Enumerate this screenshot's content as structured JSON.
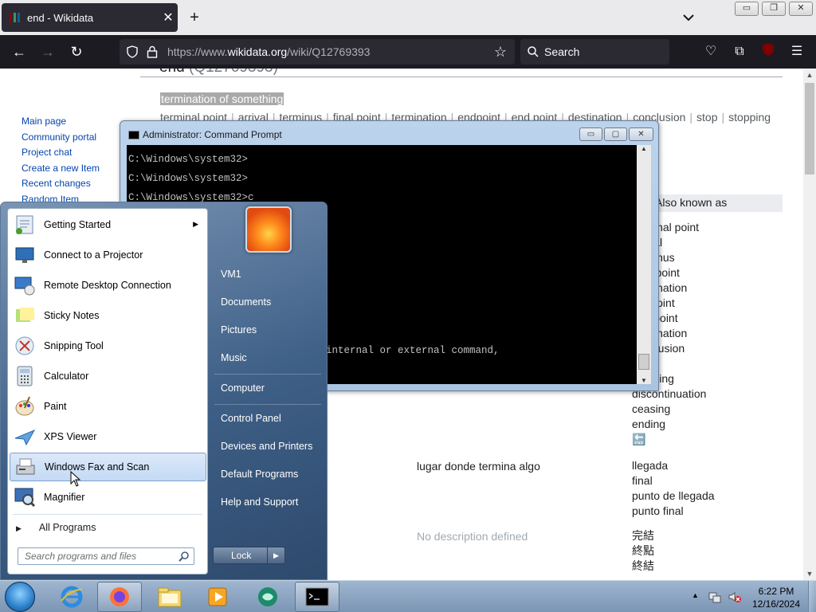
{
  "browser": {
    "tab_title": "end - Wikidata",
    "url_prefix": "https://www.",
    "url_domain": "wikidata.org",
    "url_path": "/wiki/Q12769393",
    "search_label": "Search"
  },
  "page": {
    "title": "end",
    "title_id": "(Q12769393)",
    "description": "termination of something",
    "aliases": [
      "terminal point",
      "arrival",
      "terminus",
      "final point",
      "termination",
      "endpoint",
      "end point",
      "destination",
      "conclusion",
      "stop",
      "stopping"
    ],
    "sidebar": [
      "Main page",
      "Community portal",
      "Project chat",
      "Create a new Item",
      "Recent changes",
      "Random Item"
    ],
    "also_known_as_header": "Also known as",
    "aliases_list_1": [
      "terminal point",
      "arrival",
      "terminus",
      "final point",
      "termination",
      "endpoint",
      "end point",
      "termination",
      "conclusion",
      "stop",
      "stopping",
      "discontinuation",
      "ceasing",
      "ending",
      "🔚"
    ],
    "spanish_description": "lugar donde termina algo",
    "spanish_aliases": [
      "llegada",
      "final",
      "punto de llegada",
      "punto final"
    ],
    "no_description": "No description defined",
    "chinese_aliases": [
      "完結",
      "終點",
      "終結"
    ]
  },
  "cmd": {
    "title": "Administrator: Command Prompt",
    "lines": [
      "C:\\Windows\\system32>",
      "C:\\Windows\\system32>",
      "C:\\Windows\\system32>c"
    ],
    "partial_line": "internal or external command,"
  },
  "start_menu": {
    "programs": [
      {
        "label": "Getting Started",
        "has_submenu": true
      },
      {
        "label": "Connect to a Projector"
      },
      {
        "label": "Remote Desktop Connection"
      },
      {
        "label": "Sticky Notes"
      },
      {
        "label": "Snipping Tool"
      },
      {
        "label": "Calculator"
      },
      {
        "label": "Paint"
      },
      {
        "label": "XPS Viewer"
      },
      {
        "label": "Windows Fax and Scan",
        "highlighted": true
      },
      {
        "label": "Magnifier"
      }
    ],
    "all_programs": "All Programs",
    "search_placeholder": "Search programs and files",
    "right_items": [
      "VM1",
      "Documents",
      "Pictures",
      "Music",
      "Computer",
      "Control Panel",
      "Devices and Printers",
      "Default Programs",
      "Help and Support"
    ],
    "lock_label": "Lock"
  },
  "taskbar": {
    "time": "6:22 PM",
    "date": "12/16/2024"
  }
}
